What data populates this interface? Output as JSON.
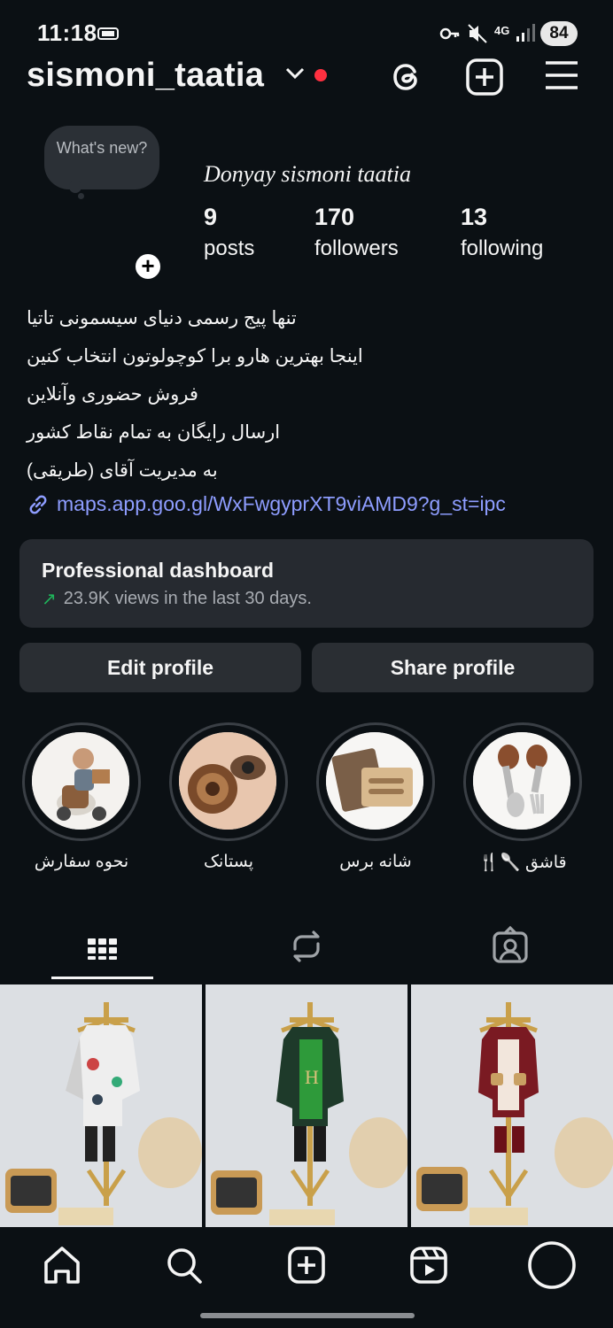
{
  "status_bar": {
    "time": "11:18",
    "battery": "84",
    "network": "4G",
    "icons": [
      "sim-icon",
      "key-icon",
      "mute-icon",
      "network-4g-icon",
      "signal-icon"
    ]
  },
  "header": {
    "username": "sismoni_taatia",
    "icons": [
      "chevron-down-icon",
      "notification-dot-icon",
      "threads-icon",
      "create-icon",
      "menu-icon"
    ],
    "accent_dot_color": "#ff3040"
  },
  "profile": {
    "note_text": "What's new?",
    "display_name": "Donyay sismoni taatia",
    "stats": [
      {
        "value": "9",
        "label": "posts"
      },
      {
        "value": "170",
        "label": "followers"
      },
      {
        "value": "13",
        "label": "following"
      }
    ],
    "bio_lines": [
      "تنها پیج رسمی دنیای سیسمونی تاتیا",
      "اینجا بهترین هارو برا کوچولوتون انتخاب کنین",
      "فروش حضوری وآنلاین",
      "ارسال رایگان به تمام نقاط کشور",
      "به مدیریت آقای (طریقی)"
    ],
    "link": "maps.app.goo.gl/WxFwgyprXT9viAMD9?g_st=ipc",
    "link_color": "#8e9dff"
  },
  "dashboard": {
    "title": "Professional dashboard",
    "subtitle": "23.9K views in the last 30 days.",
    "trend_color": "#1fb35a"
  },
  "buttons": {
    "edit": "Edit profile",
    "share": "Share profile"
  },
  "highlights": [
    {
      "label": "نحوه سفارش"
    },
    {
      "label": "پستانک"
    },
    {
      "label": "شانه برس"
    },
    {
      "label": "قاشق 🥄🍴"
    }
  ],
  "tabs": [
    "grid-icon",
    "reels-repost-icon",
    "tagged-icon"
  ],
  "bottom_nav": [
    "home-icon",
    "search-icon",
    "create-post-icon",
    "reels-icon",
    "profile-icon"
  ]
}
